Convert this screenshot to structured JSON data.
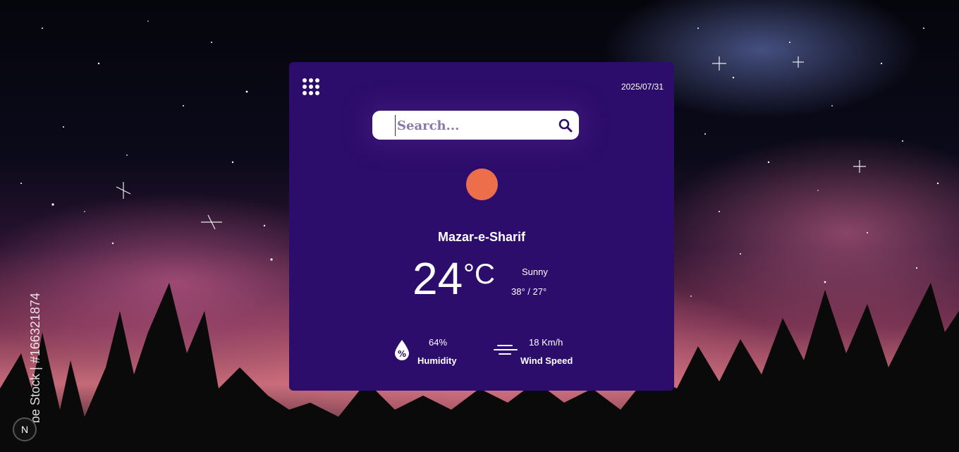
{
  "background": {
    "watermark": "be Stock | #166321874",
    "badge_letter": "N"
  },
  "card": {
    "menu_icon": "grid-menu-icon",
    "date": "2025/07/31",
    "search": {
      "placeholder": "Search...",
      "icon": "search-icon"
    },
    "weather_icon": "sun-icon",
    "city": "Mazar-e-Sharif",
    "temperature": "24",
    "unit": "°C",
    "condition": "Sunny",
    "high_low": "38° / 27°",
    "humidity": {
      "value": "64%",
      "label": "Humidity",
      "icon": "humidity-drop-icon"
    },
    "wind": {
      "value": "18 Km/h",
      "label": "Wind Speed",
      "icon": "wind-icon"
    }
  },
  "colors": {
    "card": "#2d0d6b",
    "sun": "#ec6e4b",
    "text": "#ffffff"
  }
}
